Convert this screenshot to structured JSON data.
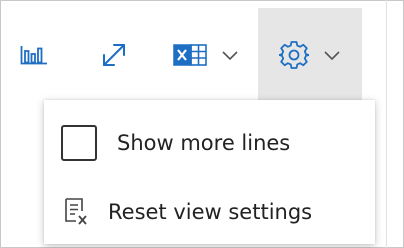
{
  "toolbar": {
    "buttons": [
      {
        "name": "bar-chart",
        "icon": "bar-chart-icon"
      },
      {
        "name": "expand",
        "icon": "expand-diagonal-icon"
      },
      {
        "name": "excel-export",
        "icon": "excel-icon",
        "has_dropdown": true
      },
      {
        "name": "settings",
        "icon": "gear-icon",
        "has_dropdown": true,
        "active": true
      }
    ],
    "accent_color": "#1e6fc4",
    "excel_color": "#1e6fc4"
  },
  "menu": {
    "items": [
      {
        "label": "Show more lines",
        "type": "checkbox",
        "checked": false,
        "icon": "checkbox-icon"
      },
      {
        "label": "Reset view settings",
        "type": "action",
        "icon": "reset-view-icon"
      }
    ]
  }
}
